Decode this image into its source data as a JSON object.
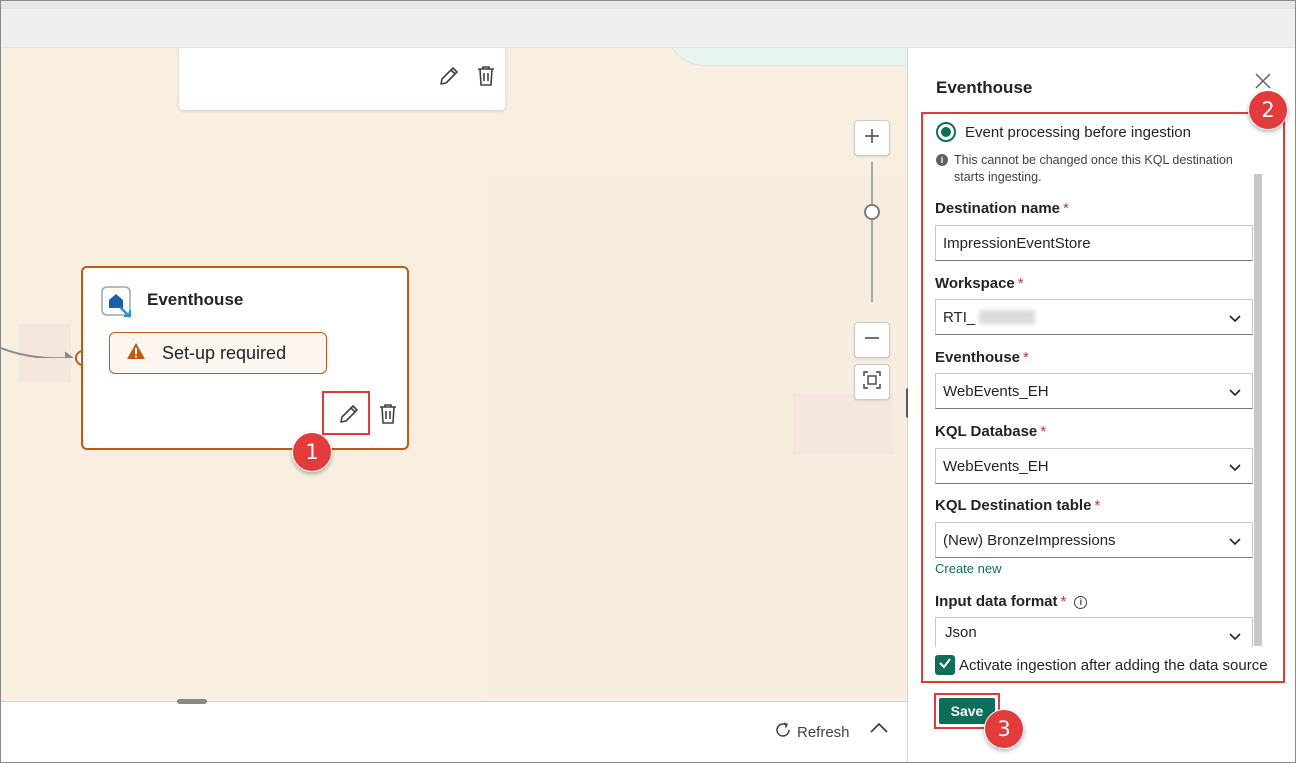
{
  "canvas": {
    "node": {
      "title": "Eventhouse",
      "status": "Set-up required"
    }
  },
  "bottom": {
    "refresh_label": "Refresh"
  },
  "panel": {
    "title": "Eventhouse",
    "radio_label": "Event processing before ingestion",
    "note": "This cannot be changed once this KQL destination starts ingesting.",
    "fields": {
      "destination_name": {
        "label": "Destination name",
        "value": "ImpressionEventStore"
      },
      "workspace": {
        "label": "Workspace",
        "value": "RTI_"
      },
      "eventhouse": {
        "label": "Eventhouse",
        "value": "WebEvents_EH"
      },
      "kql_database": {
        "label": "KQL Database",
        "value": "WebEvents_EH"
      },
      "kql_table": {
        "label": "KQL Destination table",
        "value": "(New) BronzeImpressions"
      },
      "input_format": {
        "label": "Input data format",
        "value": "Json"
      }
    },
    "create_new": "Create new",
    "activate_label": "Activate ingestion after adding the data source",
    "save_label": "Save"
  },
  "callouts": [
    "1",
    "2",
    "3"
  ],
  "colors": {
    "accent": "#0f6e5a",
    "node_border": "#c25a0f",
    "callout": "#e23b3b",
    "canvas_bg": "#f8efe1"
  },
  "icons": [
    "edit-icon",
    "delete-icon",
    "warning-icon",
    "eventhouse-icon",
    "zoom-in-icon",
    "zoom-out-icon",
    "fit-view-icon",
    "refresh-icon",
    "chevron-up-icon",
    "close-icon",
    "chevron-down-icon",
    "info-icon",
    "checkmark-icon"
  ]
}
